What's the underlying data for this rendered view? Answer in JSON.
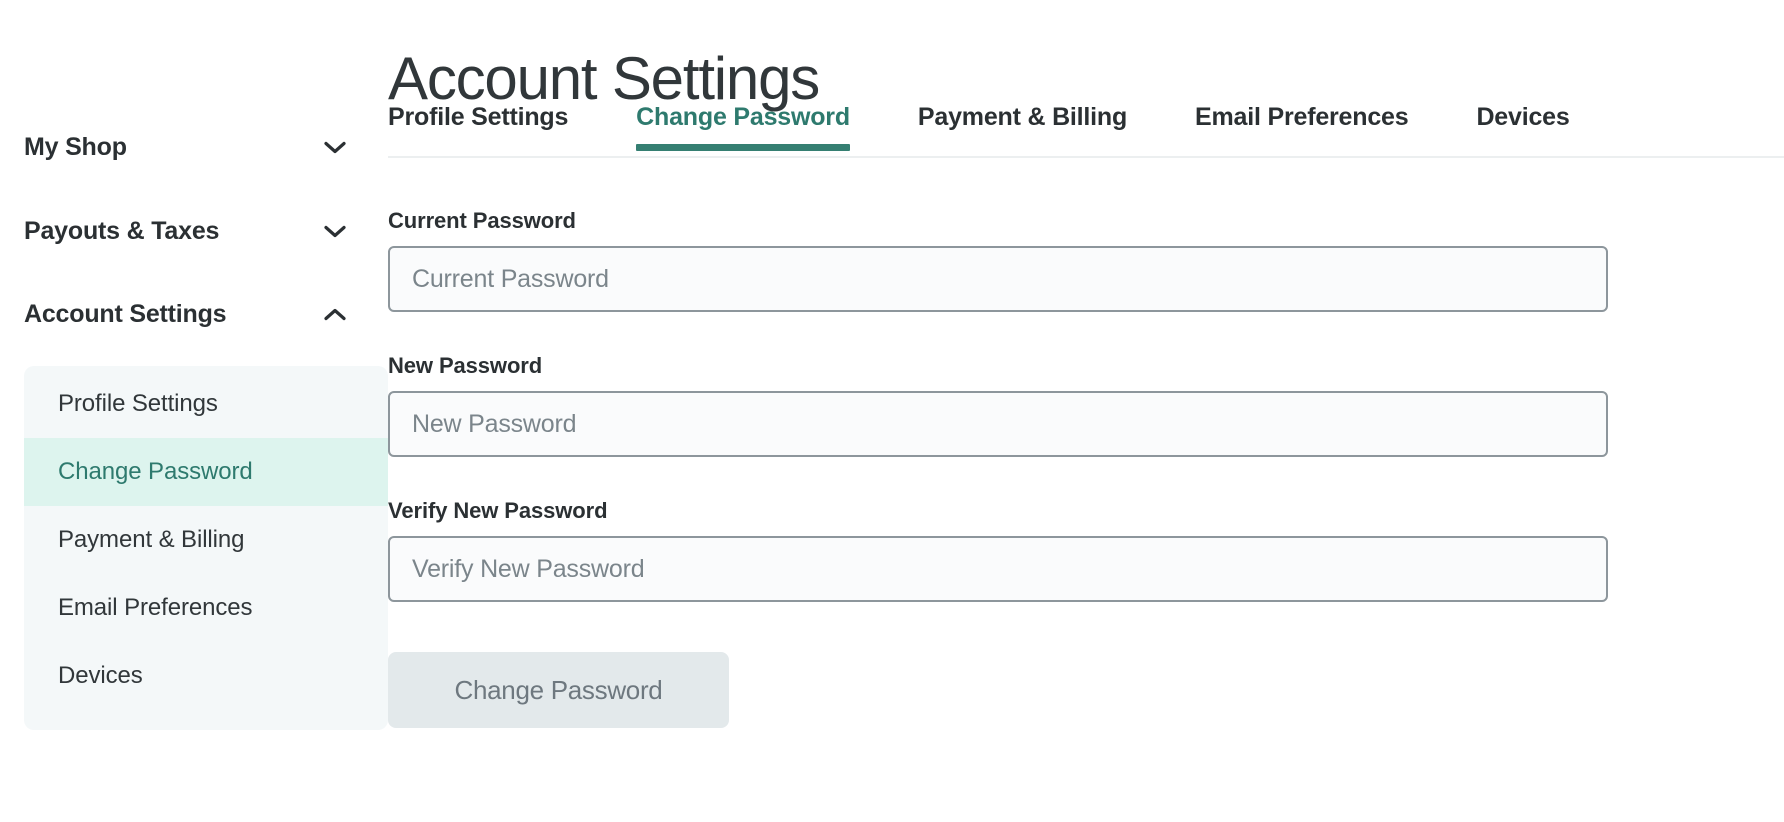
{
  "page": {
    "title": "Account Settings"
  },
  "colors": {
    "accent_teal": "#2e7a6e",
    "tab_underline": "#357f72",
    "active_subnav_bg": "#ddf4ee",
    "subnav_panel_bg": "#f4f8f9",
    "text_dark": "#2b3033",
    "input_border": "#8d969c",
    "input_bg": "#fafbfc",
    "button_bg": "#e3e9eb",
    "button_text": "#6e787f"
  },
  "sidebar": {
    "groups": [
      {
        "label": "My Shop",
        "icon": "chevron-down-icon",
        "expanded": false
      },
      {
        "label": "Payouts & Taxes",
        "icon": "chevron-down-icon",
        "expanded": false
      },
      {
        "label": "Account Settings",
        "icon": "chevron-up-icon",
        "expanded": true
      }
    ],
    "subitems": [
      {
        "label": "Profile Settings",
        "active": false
      },
      {
        "label": "Change Password",
        "active": true
      },
      {
        "label": "Payment & Billing",
        "active": false
      },
      {
        "label": "Email Preferences",
        "active": false
      },
      {
        "label": "Devices",
        "active": false
      }
    ]
  },
  "tabs": [
    {
      "label": "Profile Settings",
      "active": false
    },
    {
      "label": "Change Password",
      "active": true
    },
    {
      "label": "Payment & Billing",
      "active": false
    },
    {
      "label": "Email Preferences",
      "active": false
    },
    {
      "label": "Devices",
      "active": false
    }
  ],
  "form": {
    "fields": [
      {
        "label": "Current Password",
        "placeholder": "Current Password",
        "value": ""
      },
      {
        "label": "New Password",
        "placeholder": "New Password",
        "value": ""
      },
      {
        "label": "Verify New Password",
        "placeholder": "Verify New Password",
        "value": ""
      }
    ],
    "submit_label": "Change Password"
  }
}
